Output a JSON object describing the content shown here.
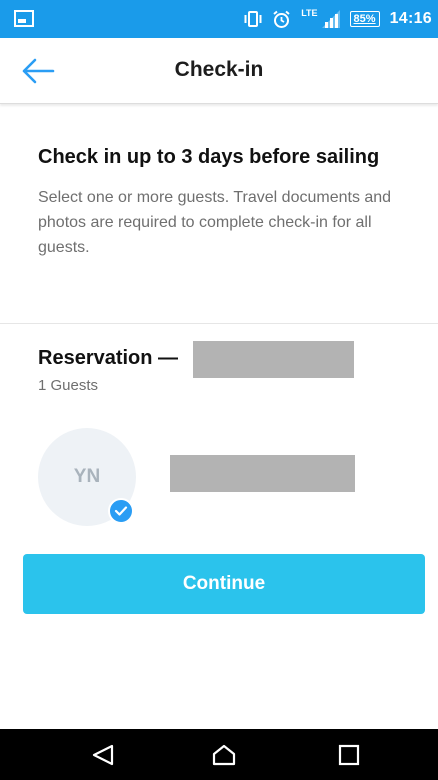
{
  "status_bar": {
    "network": "LTE",
    "battery": "85%",
    "time": "14:16",
    "icons": [
      "notification-icon",
      "vibrate-icon",
      "alarm-icon",
      "signal-icon",
      "battery-icon"
    ]
  },
  "header": {
    "title": "Check-in",
    "back_icon": "arrow-left-icon"
  },
  "intro": {
    "heading": "Check in up to 3 days before sailing",
    "description": "Select one or more guests. Travel documents and photos are required to complete check-in for all guests."
  },
  "reservation": {
    "title": "Reservation —",
    "guests": "1 Guests",
    "guest_list": [
      {
        "initials": "YN",
        "selected": true
      }
    ]
  },
  "continue_label": "Continue",
  "navbar": {
    "icons": [
      "nav-back-icon",
      "nav-home-icon",
      "nav-recent-icon"
    ]
  },
  "colors": {
    "status_bar": "#1a9bea",
    "accent": "#2bc3ec",
    "check": "#2a9df4",
    "redaction": "#b3b3b3"
  }
}
